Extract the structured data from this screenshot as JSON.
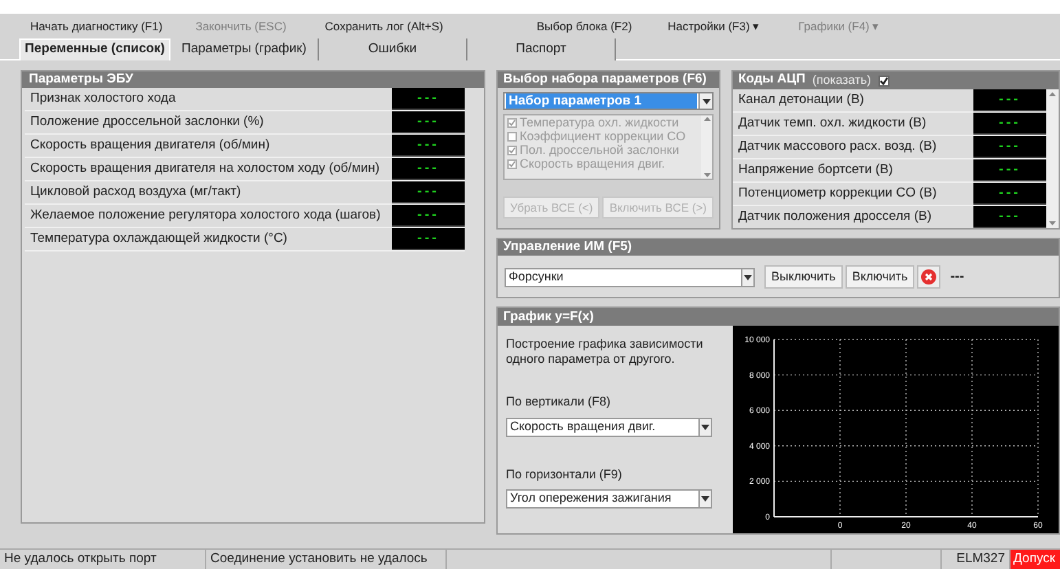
{
  "menu": [
    {
      "label": "Начать диагностику (F1)",
      "disabled": false
    },
    {
      "label": "Закончить (ESC)",
      "disabled": true
    },
    {
      "label": "Сохранить лог (Alt+S)",
      "disabled": false
    },
    {
      "label": "Выбор блока (F2)",
      "disabled": false
    },
    {
      "label": "Настройки (F3) ▾",
      "disabled": false
    },
    {
      "label": "Графики (F4) ▾",
      "disabled": true
    }
  ],
  "tabs": [
    {
      "label": "Переменные (список)",
      "selected": true
    },
    {
      "label": "Параметры (график)",
      "selected": false
    },
    {
      "label": "Ошибки",
      "selected": false
    },
    {
      "label": "Паспорт",
      "selected": false
    }
  ],
  "ecu_params": {
    "title": "Параметры ЭБУ",
    "rows": [
      {
        "name": "Признак холостого хода",
        "value": "---"
      },
      {
        "name": "Положение дроссельной заслонки (%)",
        "value": "---"
      },
      {
        "name": "Скорость вращения двигателя (об/мин)",
        "value": "---"
      },
      {
        "name": "Скорость вращения двигателя на холостом ходу (об/мин)",
        "value": "---"
      },
      {
        "name": "Цикловой расход воздуха (мг/такт)",
        "value": "---"
      },
      {
        "name": "Желаемое положение регулятора холостого хода (шагов)",
        "value": "---"
      },
      {
        "name": "Температура охлаждающей жидкости (°C)",
        "value": "---"
      }
    ]
  },
  "param_set": {
    "title": "Выбор набора параметров (F6)",
    "selected_set": "Набор параметров 1",
    "items": [
      {
        "label": "Температура охл. жидкости",
        "checked": true
      },
      {
        "label": "Коэффициент коррекции CO",
        "checked": false
      },
      {
        "label": "Пол. дроссельной заслонки",
        "checked": true
      },
      {
        "label": "Скорость вращения двиг.",
        "checked": true
      }
    ],
    "buttons": [
      "Убрать ВСЕ (<)",
      "Включить ВСЕ (>)"
    ]
  },
  "adc": {
    "title": "Коды АЦП",
    "show_label": "(показать)",
    "show_checked": true,
    "rows": [
      {
        "name": "Канал детонации (В)",
        "value": "---"
      },
      {
        "name": "Датчик темп. охл. жидкости (В)",
        "value": "---"
      },
      {
        "name": "Датчик массового расх. возд. (В)",
        "value": "---"
      },
      {
        "name": "Напряжение бортсети (В)",
        "value": "---"
      },
      {
        "name": "Потенциометр коррекции CO (В)",
        "value": "---"
      },
      {
        "name": "Датчик положения дросселя (В)",
        "value": "---"
      }
    ]
  },
  "actuators": {
    "title": "Управление ИМ (F5)",
    "device": "Форсунки",
    "buttons": [
      "Выключить",
      "Включить"
    ],
    "state": "---"
  },
  "graph": {
    "title": "График y=F(x)",
    "description": "Построение графика зависимости одного параметра от другого.",
    "vertical_label": "По вертикали (F8)",
    "vertical_value": "Скорость вращения двиг.",
    "horizontal_label": "По горизонтали (F9)",
    "horizontal_value": "Угол опережения зажигания",
    "chart_data": {
      "type": "line",
      "grid": true,
      "xlim": [
        -20,
        60
      ],
      "ylim": [
        0,
        10000
      ],
      "xticks": [
        0,
        20,
        40,
        60
      ],
      "yticks": [
        {
          "value": 0,
          "label": "0"
        },
        {
          "value": 2000,
          "label": "2 000"
        },
        {
          "value": 4000,
          "label": "4 000"
        },
        {
          "value": 6000,
          "label": "6 000"
        },
        {
          "value": 8000,
          "label": "8 000"
        },
        {
          "value": 10000,
          "label": "10 000"
        }
      ]
    }
  },
  "status_bar": [
    "Не удалось открыть порт",
    "Соединение установить не удалось",
    "ELM327",
    "Допуск"
  ]
}
